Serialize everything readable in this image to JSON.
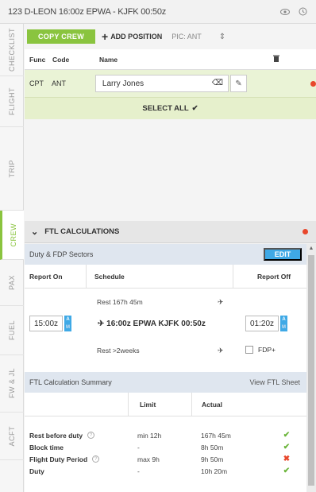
{
  "topbar": {
    "title": "123 D-LEON 16:00z EPWA - KJFK 00:50z",
    "eye_icon": "eye-icon",
    "history_icon": "history-icon"
  },
  "side_tabs": [
    {
      "label": "CHECKLIST",
      "active": false
    },
    {
      "label": "FLIGHT",
      "active": false
    },
    {
      "label": "TRIP",
      "active": false
    },
    {
      "label": "CREW",
      "active": true
    },
    {
      "label": "PAX",
      "active": false
    },
    {
      "label": "FUEL",
      "active": false
    },
    {
      "label": "FW & JL",
      "active": false
    },
    {
      "label": "ACFT",
      "active": false
    }
  ],
  "crew": {
    "copy_label": "COPY CREW",
    "add_label": "ADD POSITION",
    "pic_label": "PIC: ANT",
    "columns": {
      "func": "Func",
      "code": "Code",
      "name": "Name"
    },
    "rows": [
      {
        "func": "CPT",
        "code": "ANT",
        "name": "Larry Jones"
      }
    ],
    "select_all_label": "SELECT ALL"
  },
  "ftl": {
    "title": "FTL CALCULATIONS",
    "duty_section": "Duty & FDP Sectors",
    "edit_label": "EDIT",
    "columns": {
      "report_on": "Report On",
      "schedule": "Schedule",
      "report_off": "Report Off"
    },
    "rest_before": "Rest 167h 45m",
    "rest_after": "Rest >2weeks",
    "report_on_time": "15:00z",
    "report_off_time": "01:20z",
    "am_label": "A",
    "m_label": "M",
    "route": "16:00z EPWA KJFK 00:50z",
    "fdp_plus_label": "FDP+",
    "summary_title": "FTL Calculation Summary",
    "view_sheet_label": "View FTL Sheet",
    "summary_columns": {
      "limit": "Limit",
      "actual": "Actual"
    },
    "summary_rows": [
      {
        "label": "Rest before duty",
        "info": true,
        "limit": "min 12h",
        "actual": "167h 45m",
        "status": "ok"
      },
      {
        "label": "Block time",
        "info": false,
        "limit": "-",
        "actual": "8h 50m",
        "status": "ok"
      },
      {
        "label": "Flight Duty Period",
        "info": true,
        "limit": "max 9h",
        "actual": "9h 50m",
        "status": "bad"
      },
      {
        "label": "Duty",
        "info": false,
        "limit": "-",
        "actual": "10h 20m",
        "status": "ok"
      }
    ]
  },
  "colors": {
    "accent_green": "#8ac43f",
    "accent_blue": "#3fa9e6",
    "alert_red": "#e8472c"
  }
}
